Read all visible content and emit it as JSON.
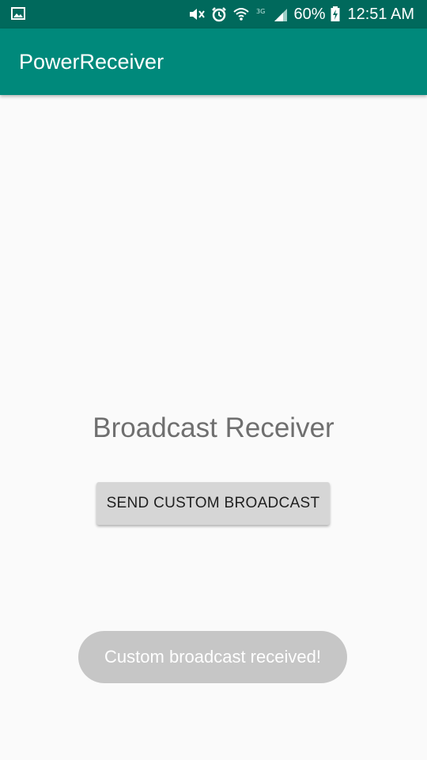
{
  "status_bar": {
    "left_icon": "image-icon",
    "battery_percent": "60%",
    "clock": "12:51 AM",
    "icons": [
      "mute-icon",
      "alarm-icon",
      "wifi-icon",
      "network-type-icon",
      "signal-icon",
      "battery-charging-icon"
    ],
    "network_label": "3G"
  },
  "app_bar": {
    "title": "PowerReceiver"
  },
  "main": {
    "heading": "Broadcast Receiver",
    "send_button_label": "SEND CUSTOM BROADCAST"
  },
  "toast": {
    "message": "Custom broadcast received!"
  },
  "colors": {
    "status_bar": "#00695c",
    "app_bar": "#00897b",
    "background": "#fafafa",
    "button": "#d6d6d6",
    "toast": "#c6c6c6"
  }
}
